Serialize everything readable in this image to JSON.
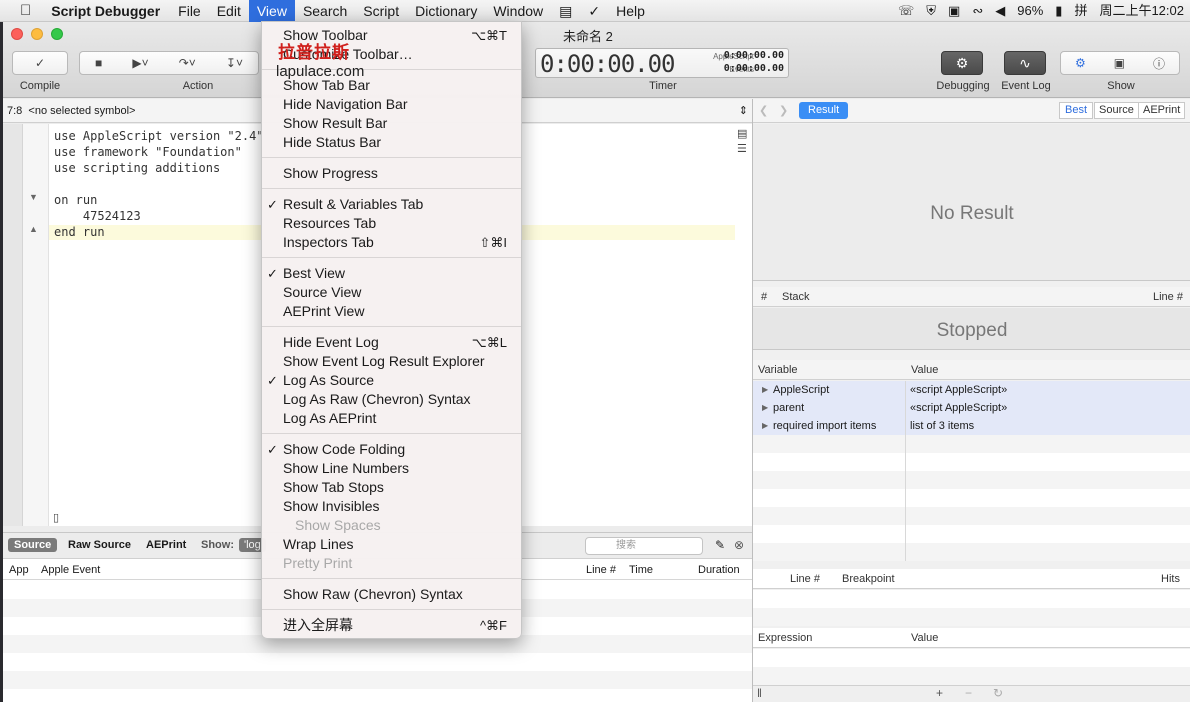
{
  "menubar": {
    "apple": "",
    "app_name": "Script Debugger",
    "items": [
      "File",
      "Edit",
      "View",
      "Search",
      "Script",
      "Dictionary",
      "Window",
      "Help"
    ],
    "battery": "96%",
    "input_method": "拼",
    "clock": "周二上午12:02"
  },
  "window": {
    "title": "未命名 2",
    "toolbar": {
      "compile_label": "Compile",
      "action_label": "Action",
      "timer_label": "Timer",
      "timer_value": "0:00:00.00",
      "applescript_label": "AppleScript",
      "applescript_value": "0:00:00.00",
      "events_label": "Events",
      "events_value": "0:00:00.00",
      "debugging_label": "Debugging",
      "event_log_label": "Event Log",
      "show_label": "Show"
    },
    "selector": {
      "position": "7:8",
      "symbol": "<no selected symbol>"
    },
    "code_lines": [
      "use AppleScript version \"2.4\"",
      "use framework \"Foundation\"",
      "use scripting additions",
      "",
      "on run",
      "    47524123",
      "end run"
    ],
    "log_tabs": {
      "source": "Source",
      "raw_source": "Raw Source",
      "aeprint": "AEPrint",
      "show": "Show:",
      "show_value": "'log",
      "search_placeholder": "搜索"
    },
    "log_columns": [
      "App",
      "Apple Event",
      "Line #",
      "Time",
      "Duration"
    ]
  },
  "right_panel": {
    "result_tab": "Result",
    "view_tabs": [
      "Best",
      "Source",
      "AEPrint"
    ],
    "no_result": "No Result",
    "stack_columns": [
      "#",
      "Stack",
      "Line #"
    ],
    "stopped": "Stopped",
    "variable_columns": [
      "Variable",
      "Value"
    ],
    "variables": [
      {
        "name": "AppleScript",
        "value": "«script AppleScript»"
      },
      {
        "name": "parent",
        "value": "«script AppleScript»"
      },
      {
        "name": "required import items",
        "value": "list of 3 items"
      }
    ],
    "breakpoint_columns": [
      "Line #",
      "Breakpoint",
      "Hits"
    ],
    "expression_columns": [
      "Expression",
      "Value"
    ]
  },
  "view_menu": {
    "items": [
      {
        "label": "Show Toolbar",
        "shortcut": "⌥⌘T"
      },
      {
        "label": "Customize Toolbar…"
      },
      {
        "label": "Show Tab Bar"
      },
      {
        "label": "Hide Navigation Bar"
      },
      {
        "label": "Show Result Bar"
      },
      {
        "label": "Hide Status Bar"
      },
      {
        "label": "Show Progress"
      },
      {
        "label": "Result & Variables Tab",
        "checked": true
      },
      {
        "label": "Resources Tab"
      },
      {
        "label": "Inspectors Tab",
        "shortcut": "⇧⌘I"
      },
      {
        "label": "Best View",
        "checked": true
      },
      {
        "label": "Source View"
      },
      {
        "label": "AEPrint View"
      },
      {
        "label": "Hide Event Log",
        "shortcut": "⌥⌘L"
      },
      {
        "label": "Show Event Log Result Explorer"
      },
      {
        "label": "Log As Source",
        "checked": true
      },
      {
        "label": "Log As Raw (Chevron) Syntax"
      },
      {
        "label": "Log As AEPrint"
      },
      {
        "label": "Show Code Folding",
        "checked": true
      },
      {
        "label": "Show Line Numbers"
      },
      {
        "label": "Show Tab Stops"
      },
      {
        "label": "Show Invisibles"
      },
      {
        "label": "Show Spaces",
        "disabled": true
      },
      {
        "label": "Wrap Lines"
      },
      {
        "label": "Pretty Print",
        "disabled": true
      },
      {
        "label": "Show Raw (Chevron) Syntax"
      },
      {
        "label": "进入全屏幕",
        "shortcut": "^⌘F"
      }
    ]
  },
  "watermark": {
    "cn": "拉普拉斯",
    "url": "lapulace.com"
  },
  "colors": {
    "accent": "#2f6ede",
    "highlight": "#fcfadc",
    "variable_row": "#e3e8f8"
  }
}
